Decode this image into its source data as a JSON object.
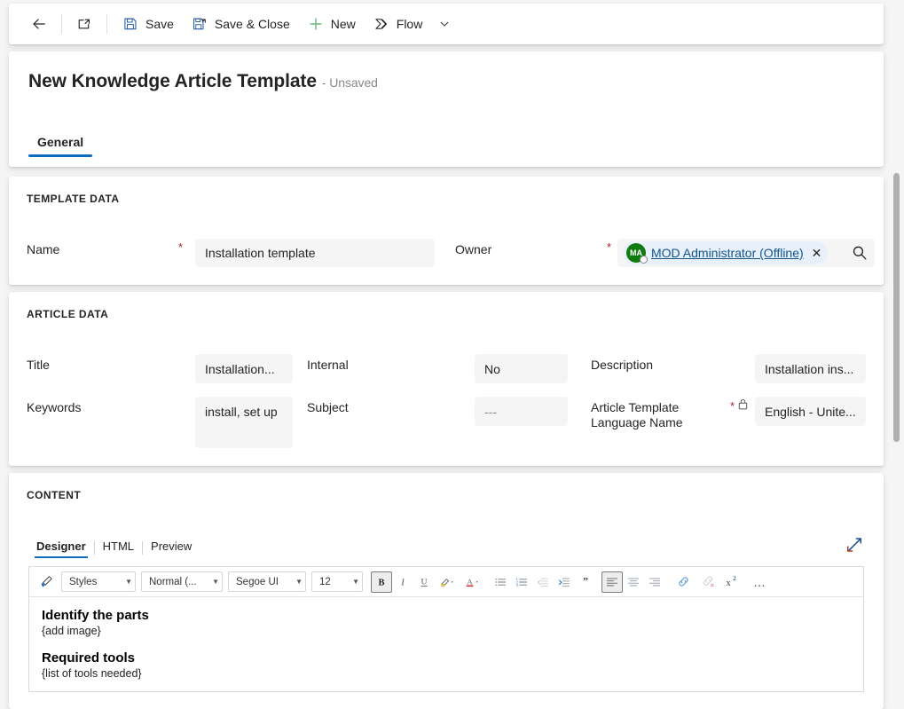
{
  "commandbar": {
    "back_label": "",
    "popout_label": "",
    "buttons": [
      {
        "id": "save",
        "label": "Save",
        "icon": "save-icon"
      },
      {
        "id": "save_close",
        "label": "Save & Close",
        "icon": "save-close-icon"
      },
      {
        "id": "new",
        "label": "New",
        "icon": "plus-icon"
      },
      {
        "id": "flow",
        "label": "Flow",
        "icon": "flow-icon"
      }
    ]
  },
  "header": {
    "title": "New Knowledge Article Template",
    "subtitle": "- Unsaved",
    "tabs": [
      {
        "label": "General",
        "active": true
      }
    ]
  },
  "template_data": {
    "section_title": "TEMPLATE DATA",
    "name": {
      "label": "Name",
      "value": "Installation template",
      "required": "*"
    },
    "owner": {
      "label": "Owner",
      "required": "*",
      "initials": "MA",
      "value": "MOD Administrator (Offline)",
      "remove": "✕"
    }
  },
  "article_data": {
    "section_title": "ARTICLE DATA",
    "title": {
      "label": "Title",
      "value": "Installation..."
    },
    "keywords": {
      "label": "Keywords",
      "value": "install, set up"
    },
    "internal": {
      "label": "Internal",
      "value": "No"
    },
    "subject": {
      "label": "Subject",
      "value": "---"
    },
    "description": {
      "label": "Description",
      "value": "Installation ins..."
    },
    "language": {
      "label": "Article Template Language Name",
      "value": "English - Unite...",
      "required": "*",
      "locked": true
    }
  },
  "content": {
    "section_title": "CONTENT",
    "tabs": [
      {
        "label": "Designer",
        "active": true
      },
      {
        "label": "HTML",
        "active": false
      },
      {
        "label": "Preview",
        "active": false
      }
    ],
    "expand_label": "",
    "toolbar": {
      "styles": "Styles",
      "format": "Normal (...",
      "font": "Segoe UI",
      "size": "12",
      "buttons": [
        {
          "id": "format-painter",
          "state": "normal"
        },
        {
          "id": "bold",
          "state": "pressed"
        },
        {
          "id": "italic",
          "state": "normal"
        },
        {
          "id": "underline",
          "state": "normal"
        },
        {
          "id": "highlight",
          "state": "normal"
        },
        {
          "id": "font-color",
          "state": "normal"
        },
        {
          "id": "bullet-list",
          "state": "normal"
        },
        {
          "id": "numbered-list",
          "state": "normal"
        },
        {
          "id": "outdent",
          "state": "disabled"
        },
        {
          "id": "indent",
          "state": "normal"
        },
        {
          "id": "blockquote",
          "state": "normal"
        },
        {
          "id": "align-left",
          "state": "pressed"
        },
        {
          "id": "align-center",
          "state": "normal"
        },
        {
          "id": "align-right",
          "state": "normal"
        },
        {
          "id": "insert-link",
          "state": "normal"
        },
        {
          "id": "remove-link",
          "state": "disabled"
        },
        {
          "id": "superscript",
          "state": "normal"
        },
        {
          "id": "more",
          "state": "normal"
        }
      ],
      "more_glyph": "…"
    },
    "body": {
      "heading1": "Identify the parts",
      "text1": "{add image}",
      "heading2": "Required tools",
      "text2": "{list of tools needed}"
    }
  },
  "colors": {
    "accent": "#0f6cbd",
    "required": "#a4262c",
    "link": "#0f548c",
    "avatar_bg": "#107c10",
    "field_bg": "#f5f5f5",
    "page_bg": "#f5f5f5",
    "new_plus": "#6bb77b"
  }
}
